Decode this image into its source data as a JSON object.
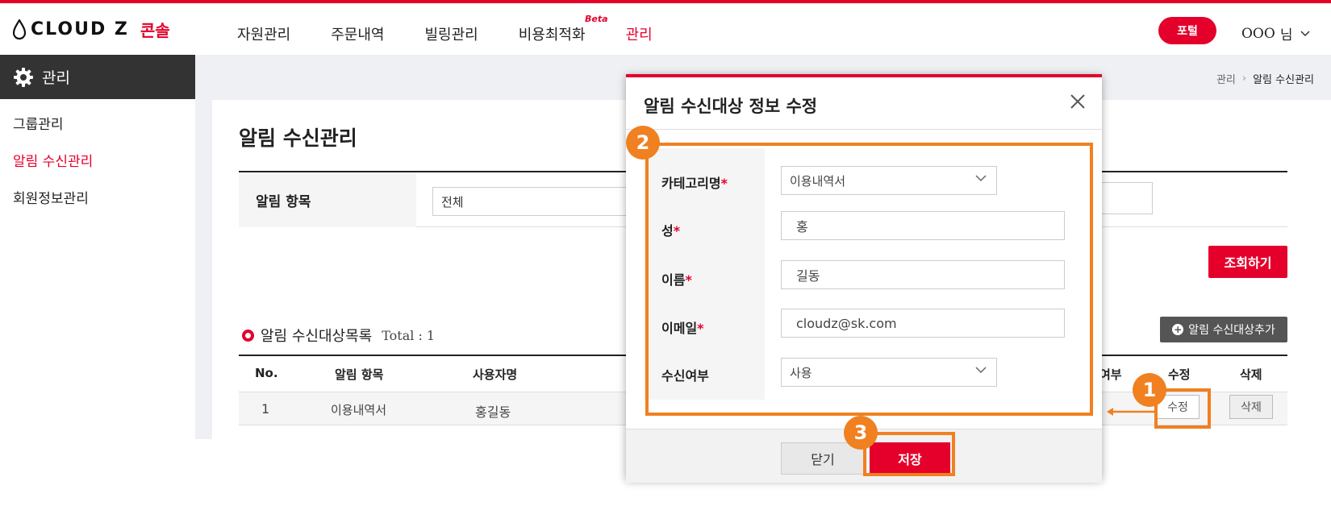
{
  "brand": {
    "logo_text": "CLOUD Z",
    "logo_sub": "콘솔"
  },
  "gnb": [
    {
      "label": "자원관리",
      "active": false
    },
    {
      "label": "주문내역",
      "active": false
    },
    {
      "label": "빌링관리",
      "active": false
    },
    {
      "label": "비용최적화",
      "active": false,
      "badge": "Beta"
    },
    {
      "label": "관리",
      "active": true
    }
  ],
  "header": {
    "portal_label": "포털",
    "user_name": "OOO",
    "user_suffix": "님"
  },
  "sidebar": {
    "title": "관리",
    "items": [
      {
        "label": "그룹관리",
        "active": false
      },
      {
        "label": "알림 수신관리",
        "active": true
      },
      {
        "label": "회원정보관리",
        "active": false
      }
    ]
  },
  "breadcrumb": {
    "parent": "관리",
    "current": "알림 수신관리"
  },
  "page": {
    "title": "알림 수신관리",
    "filter_label": "알림 항목",
    "filter_value": "전체",
    "search_label": "조회하기",
    "list_title": "알림 수신대상목록",
    "total_text": "Total : 1",
    "add_label": "알림 수신대상추가"
  },
  "table": {
    "headers": [
      "No.",
      "알림 항목",
      "사용자명",
      "여부",
      "수정",
      "삭제"
    ],
    "rows": [
      {
        "no": "1",
        "category": "이용내역서",
        "user": "홍길동",
        "edit": "수정",
        "delete": "삭제"
      }
    ]
  },
  "modal": {
    "title": "알림 수신대상 정보 수정",
    "fields": {
      "category_label": "카테고리명",
      "category_value": "이용내역서",
      "lastname_label": "성",
      "lastname_value": "홍",
      "firstname_label": "이름",
      "firstname_value": "길동",
      "email_label": "이메일",
      "email_value": "cloudz@sk.com",
      "receive_label": "수신여부",
      "receive_value": "사용"
    },
    "required_mark": "*",
    "close_label": "닫기",
    "save_label": "저장"
  },
  "annotations": {
    "step1": "1",
    "step2": "2",
    "step3": "3"
  },
  "colors": {
    "accent": "#e4002b",
    "annotation": "#f08020",
    "sidebar_head": "#333333",
    "content_bg": "#eef0f3"
  }
}
